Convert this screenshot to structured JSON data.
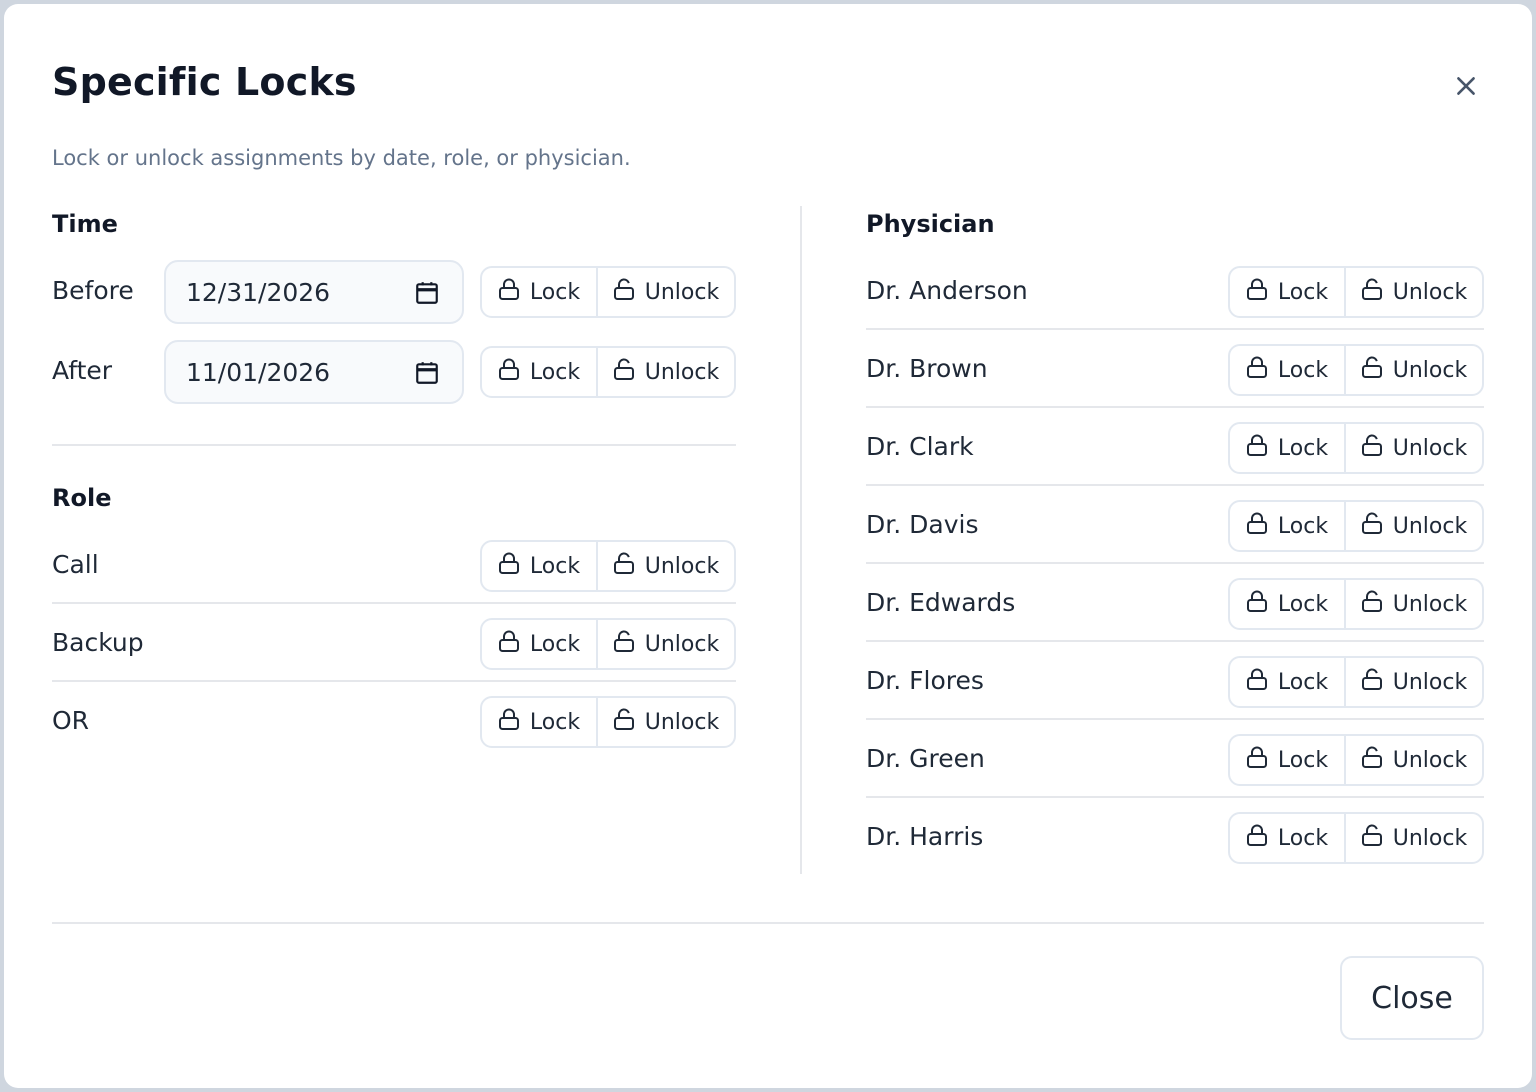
{
  "dialog": {
    "title": "Specific Locks",
    "subtitle": "Lock or unlock assignments by date, role, or physician.",
    "close_label": "Close"
  },
  "buttons": {
    "lock": "Lock",
    "unlock": "Unlock"
  },
  "time": {
    "title": "Time",
    "rows": [
      {
        "label": "Before",
        "value": "12/31/2026"
      },
      {
        "label": "After",
        "value": "11/01/2026"
      }
    ]
  },
  "role": {
    "title": "Role",
    "rows": [
      "Call",
      "Backup",
      "OR"
    ]
  },
  "physician": {
    "title": "Physician",
    "rows": [
      "Dr. Anderson",
      "Dr. Brown",
      "Dr. Clark",
      "Dr. Davis",
      "Dr. Edwards",
      "Dr. Flores",
      "Dr. Green",
      "Dr. Harris"
    ]
  },
  "icons": {
    "close": "close-icon",
    "lock": "lock-icon",
    "unlock": "unlock-icon",
    "calendar": "calendar-icon"
  }
}
